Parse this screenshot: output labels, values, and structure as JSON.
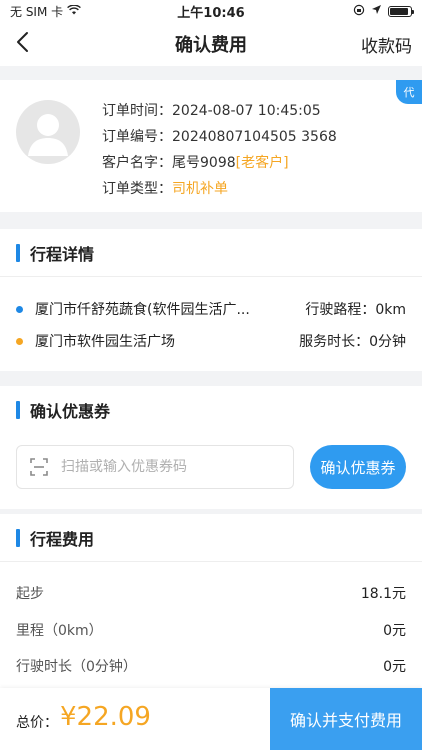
{
  "status_bar": {
    "carrier": "无 SIM 卡",
    "time": "上午10:46",
    "battery_level": 0.9
  },
  "nav": {
    "title": "确认费用",
    "right_action": "收款码"
  },
  "order": {
    "badge": "代",
    "time_label": "订单时间：",
    "time_value": "2024-08-07 10:45:05",
    "number_label": "订单编号：",
    "number_value": "20240807104505 3568",
    "customer_label": "客户名字：",
    "customer_value": "尾号9098",
    "customer_tag": "[老客户]",
    "type_label": "订单类型：",
    "type_value": "司机补单"
  },
  "trip": {
    "title": "行程详情",
    "start_address": "厦门市仟舒苑蔬食(软件园生活广...",
    "distance_label": "行驶路程：",
    "distance_value": "0km",
    "end_address": "厦门市软件园生活广场",
    "duration_label": "服务时长：",
    "duration_value": "0分钟",
    "start_color": "#1e88e5",
    "end_color": "#f5a623"
  },
  "coupon": {
    "title": "确认优惠券",
    "placeholder": "扫描或输入优惠券码",
    "button": "确认优惠券"
  },
  "fees": {
    "title": "行程费用",
    "items": [
      {
        "label": "起步",
        "amount": "18.1元"
      },
      {
        "label": "里程（0km）",
        "amount": "0元"
      },
      {
        "label": "行驶时长（0分钟）",
        "amount": "0元"
      }
    ]
  },
  "footer": {
    "total_label": "总价：",
    "total_value": "¥22.09",
    "pay_button": "确认并支付费用"
  },
  "colors": {
    "accent": "#2f9bf0",
    "orange": "#f5a623"
  }
}
